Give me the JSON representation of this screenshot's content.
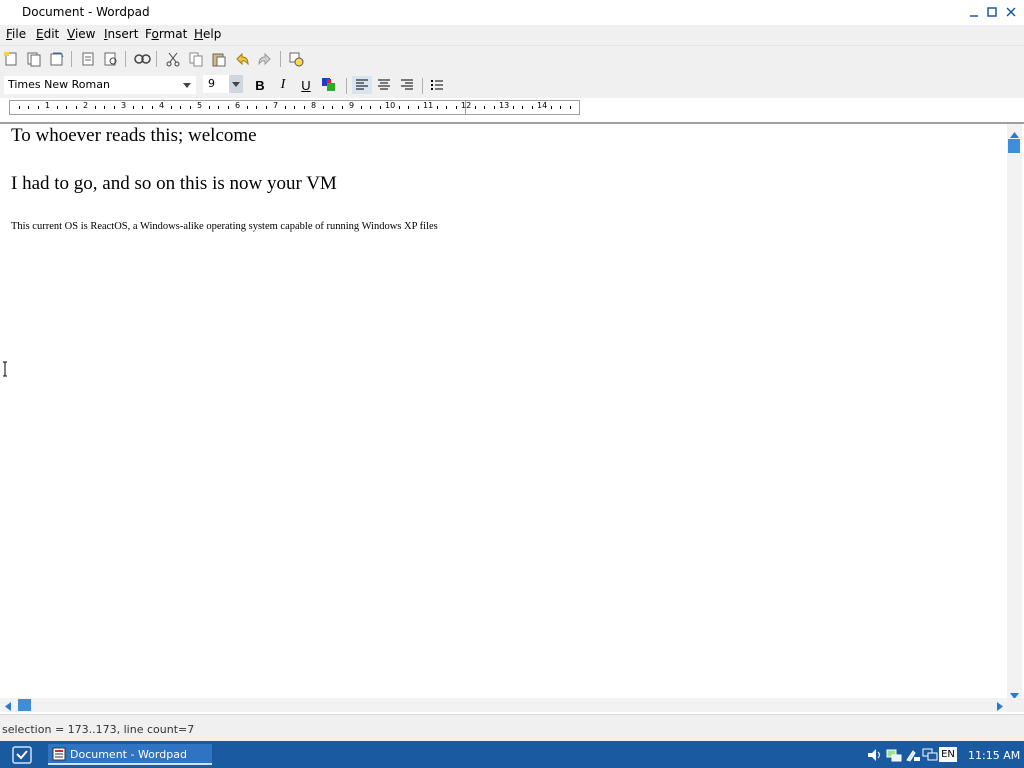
{
  "window": {
    "title": "Document - Wordpad"
  },
  "menu": [
    {
      "label_ul": "F",
      "label_rest": "ile"
    },
    {
      "label_ul": "E",
      "label_rest": "dit"
    },
    {
      "label_ul": "V",
      "label_rest": "iew"
    },
    {
      "label_ul": "I",
      "label_rest": "nsert"
    },
    {
      "label_pre": "F",
      "label_ul": "o",
      "label_rest": "rmat"
    },
    {
      "label_ul": "H",
      "label_rest": "elp"
    }
  ],
  "toolbar": {
    "icons": [
      "new-icon",
      "open-icon",
      "save-icon",
      "print-icon",
      "print-preview-icon",
      "find-icon",
      "cut-icon",
      "copy-icon",
      "paste-icon",
      "undo-icon",
      "redo-icon",
      "insert-datetime-icon"
    ]
  },
  "format": {
    "font_name": "Times New Roman",
    "font_size": "9",
    "bold": "B",
    "italic": "I",
    "underline": "U"
  },
  "ruler": {
    "labels": [
      "1",
      "2",
      "3",
      "4",
      "5",
      "6",
      "7",
      "8",
      "9",
      "10",
      "11",
      "12",
      "13",
      "14"
    ]
  },
  "document": {
    "line1": "To whoever reads this; welcome",
    "line2": "I had to go, and so on this is now your VM",
    "line3": "This current OS is ReactOS, a Windows-alike operating system capable of running Windows XP files"
  },
  "status": {
    "text": "selection = 173..173, line count=7"
  },
  "taskbar": {
    "task_label": "Document - Wordpad",
    "language": "EN",
    "clock": "11:15 AM"
  },
  "colors": {
    "taskbar": "#1a5aa0",
    "accent": "#3c8fd8"
  }
}
